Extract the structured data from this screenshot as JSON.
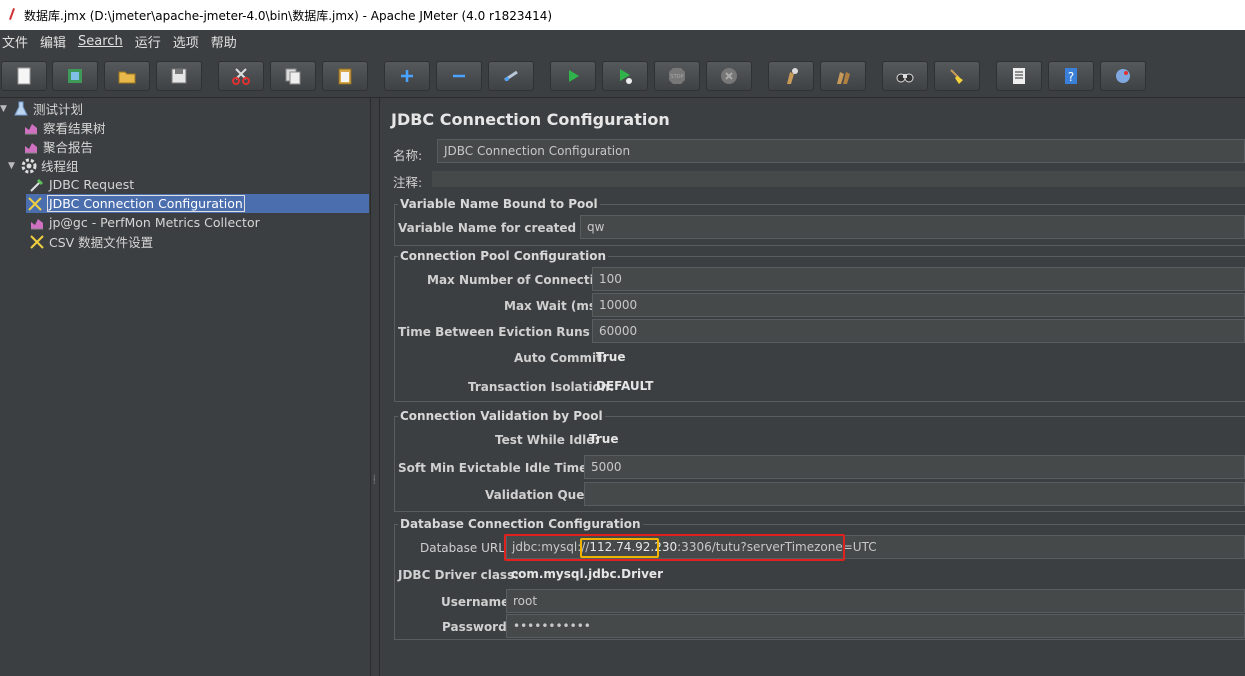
{
  "window": {
    "title": "数据库.jmx (D:\\jmeter\\apache-jmeter-4.0\\bin\\数据库.jmx) - Apache JMeter (4.0 r1823414)"
  },
  "menu": [
    "文件",
    "编辑",
    "Search",
    "运行",
    "选项",
    "帮助"
  ],
  "toolbar": [
    {
      "name": "new-icon"
    },
    {
      "name": "templates-icon"
    },
    {
      "name": "open-icon"
    },
    {
      "name": "save-icon"
    },
    {
      "name": "cut-icon"
    },
    {
      "name": "copy-icon"
    },
    {
      "name": "paste-icon"
    },
    {
      "name": "expand-icon"
    },
    {
      "name": "collapse-icon"
    },
    {
      "name": "toggle-icon"
    },
    {
      "name": "start-icon"
    },
    {
      "name": "start-no-pauses-icon"
    },
    {
      "name": "stop-icon",
      "label": "STOP"
    },
    {
      "name": "shutdown-icon"
    },
    {
      "name": "clear-icon"
    },
    {
      "name": "clear-all-icon"
    },
    {
      "name": "search-icon"
    },
    {
      "name": "reset-search-icon"
    },
    {
      "name": "function-helper-icon"
    },
    {
      "name": "help-icon"
    },
    {
      "name": "remote-icon"
    }
  ],
  "tree": [
    {
      "label": "测试计划",
      "icon": "test-plan-icon",
      "level": 0,
      "toggle": "▼"
    },
    {
      "label": "察看结果树",
      "icon": "listener-icon",
      "level": 1
    },
    {
      "label": "聚合报告",
      "icon": "listener-icon",
      "level": 1
    },
    {
      "label": "线程组",
      "icon": "thread-group-icon",
      "level": 0,
      "toggle": "▼"
    },
    {
      "label": "JDBC Request",
      "icon": "sampler-icon",
      "level": 2
    },
    {
      "label": "JDBC Connection Configuration",
      "icon": "config-icon",
      "level": 2,
      "selected": true
    },
    {
      "label": "jp@gc - PerfMon Metrics Collector",
      "icon": "listener-icon",
      "level": 2
    },
    {
      "label": "CSV 数据文件设置",
      "icon": "config-icon",
      "level": 2
    }
  ],
  "panel": {
    "title": "JDBC Connection Configuration",
    "name_label": "名称:",
    "name_value": "JDBC Connection Configuration",
    "comment_label": "注释:",
    "comment_value": ""
  },
  "groups": {
    "bound": {
      "title": "Variable Name Bound to Pool",
      "var_label": "Variable Name for created pool:",
      "var_value": "qw"
    },
    "pool": {
      "title": "Connection Pool Configuration",
      "max_conn_label": "Max Number of Connections:",
      "max_conn_value": "100",
      "max_wait_label": "Max Wait (ms):",
      "max_wait_value": "10000",
      "evict_label": "Time Between Eviction Runs (ms):",
      "evict_value": "60000",
      "autocommit_label": "Auto Commit:",
      "autocommit_value": "True",
      "isolation_label": "Transaction Isolation:",
      "isolation_value": "DEFAULT"
    },
    "validation": {
      "title": "Connection Validation by Pool",
      "test_idle_label": "Test While Idle:",
      "test_idle_value": "True",
      "soft_min_label": "Soft Min Evictable Idle Time(ms):",
      "soft_min_value": "5000",
      "query_label": "Validation Query:",
      "query_value": ""
    },
    "db": {
      "title": "Database Connection Configuration",
      "url_label": "Database URL:",
      "url_prefix": "jdbc:mysql://",
      "url_host": "112.74.92.230",
      "url_suffix": ":3306/tutu?serverTimezone=UTC",
      "driver_label": "JDBC Driver class:",
      "driver_value": "com.mysql.jdbc.Driver",
      "username_label": "Username:",
      "username_value": "root",
      "password_label": "Password:",
      "password_value": "•••••••••••"
    }
  },
  "colors": {
    "selection": "#4b6eaf",
    "highlight_red": "#e0211d",
    "highlight_orange": "#f0b400"
  }
}
